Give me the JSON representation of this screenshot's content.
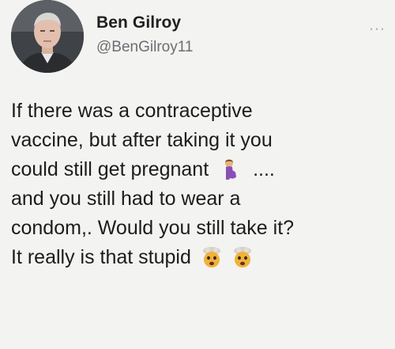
{
  "tweet": {
    "author_name": "Ben Gilroy",
    "author_handle": "@BenGilroy11",
    "more_icon_text": "…",
    "lines": [
      "If there was a contraceptive",
      "vaccine, but after taking it you",
      "could still get pregnant",
      "and you still had to wear a",
      "condom,. Would you still take it?",
      "It really is that stupid"
    ],
    "line3_suffix": "....",
    "icons": {
      "line3": "pregnant-woman-emoji",
      "line6": [
        "exploding-head-emoji",
        "exploding-head-emoji"
      ]
    }
  }
}
